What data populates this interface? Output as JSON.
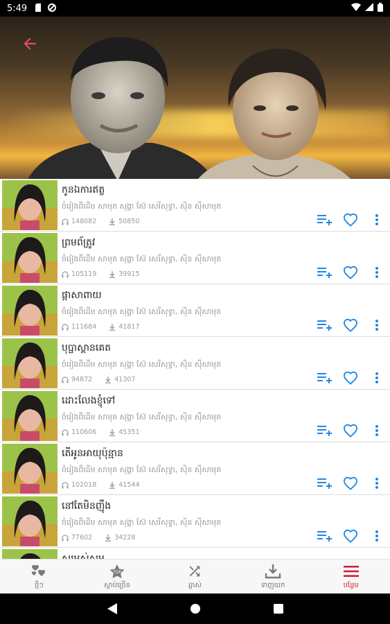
{
  "status_bar": {
    "time": "5:49"
  },
  "colors": {
    "accent_red": "#d0203a",
    "icon_blue": "#1e88e5",
    "back_arrow": "#e64a6f"
  },
  "songs": [
    {
      "title": "កូនឯការឥត្ខ",
      "subtitle": "ចំរៀងពីដើម សាមុត សុង្គា ស៊ែ សេរីសុទ្ធា, ស៊ិន ស៊ីសាមុត",
      "plays": "148082",
      "downloads": "50850"
    },
    {
      "title": "ព្រមព័ត្រូវ",
      "subtitle": "ចំរៀងពីដើម សាមុត សុង្គា ស៊ែ សេរីសុទ្ធា, ស៊ិន ស៊ីសាមុត",
      "plays": "105119",
      "downloads": "39915"
    },
    {
      "title": "ផ្កាសាពាយ",
      "subtitle": "ចំរៀងពីដើម សាមុត សុង្គា ស៊ែ សេរីសុទ្ធា, ស៊ិន ស៊ីសាមុត",
      "plays": "111684",
      "downloads": "41817"
    },
    {
      "title": "បុប្ផាស្ពានគេត",
      "subtitle": "ចំរៀងពីដើម សាមុត សុង្គា ស៊ែ សេរីសុទ្ធា, ស៊ិន ស៊ីសាមុត",
      "plays": "94872",
      "downloads": "41307"
    },
    {
      "title": "ដោះលែងខ្ញុំទៅ",
      "subtitle": "ចំរៀងពីដើម សាមុត សុង្គា ស៊ែ សេរីសុទ្ធា, ស៊ិន ស៊ីសាមុត",
      "plays": "110606",
      "downloads": "45351"
    },
    {
      "title": "តើអូនអាយុប៉ុន្មាន",
      "subtitle": "ចំរៀងពីដើម សាមុត សុង្គា ស៊ែ សេរីសុទ្ធា, ស៊ិន ស៊ីសាមុត",
      "plays": "102018",
      "downloads": "41544"
    },
    {
      "title": "នៅតែមិនញ៉ឹង",
      "subtitle": "ចំរៀងពីដើម សាមុត សុង្គា ស៊ែ សេរីសុទ្ធា, ស៊ិន ស៊ីសាមុត",
      "plays": "77602",
      "downloads": "34228"
    },
    {
      "title": "សម្រស់សម",
      "subtitle": "",
      "plays": "",
      "downloads": ""
    }
  ],
  "bottom_nav": [
    {
      "label": "ថ្មីៗ",
      "icon": "hearts-icon",
      "active": false
    },
    {
      "label": "ស្តាប់ច្រើន",
      "icon": "top-star-icon",
      "active": false
    },
    {
      "label": "ឆ្លាស់",
      "icon": "shuffle-icon",
      "active": false
    },
    {
      "label": "ទាញយក",
      "icon": "download-icon",
      "active": false
    },
    {
      "label": "បន្ថែម",
      "icon": "menu-icon",
      "active": true
    }
  ]
}
